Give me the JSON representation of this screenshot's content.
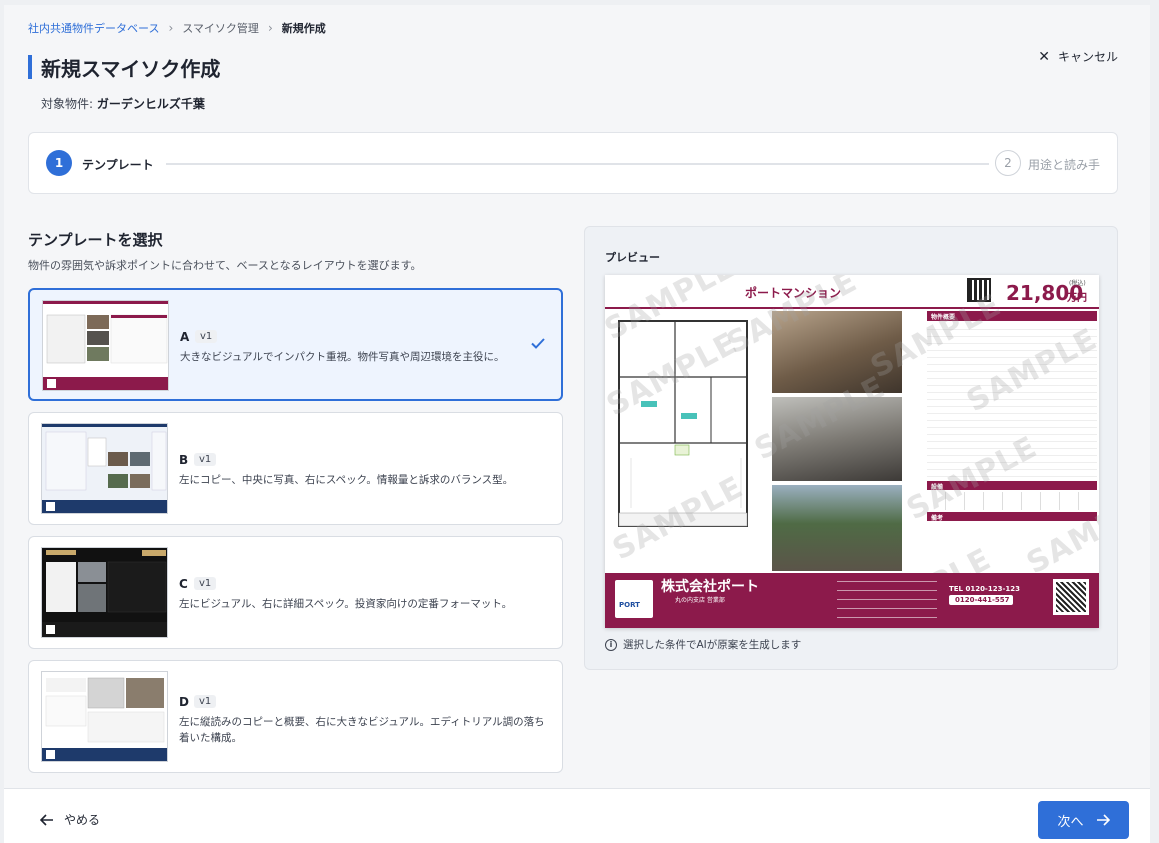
{
  "breadcrumb": {
    "root": "社内共通物件データベース",
    "parent": "スマイソク管理",
    "current": "新規作成"
  },
  "header": {
    "title": "新規スマイソク作成",
    "property_label": "対象物件: ",
    "property_name": "ガーデンヒルズ千葉",
    "cancel_label": "キャンセル"
  },
  "stepper": {
    "steps": [
      {
        "number": "1",
        "label": "テンプレート",
        "active": true
      },
      {
        "number": "2",
        "label": "用途と読み手",
        "active": false
      }
    ]
  },
  "templates_section": {
    "title": "テンプレートを選択",
    "description": "物件の雰囲気や訴求ポイントに合わせて、ベースとなるレイアウトを選びます。"
  },
  "templates": [
    {
      "name": "A",
      "version": "v1",
      "description": "大きなビジュアルでインパクト重視。物件写真や周辺環境を主役に。",
      "selected": true
    },
    {
      "name": "B",
      "version": "v1",
      "description": "左にコピー、中央に写真、右にスペック。情報量と訴求のバランス型。",
      "selected": false
    },
    {
      "name": "C",
      "version": "v1",
      "description": "左にビジュアル、右に詳細スペック。投資家向けの定番フォーマット。",
      "selected": false
    },
    {
      "name": "D",
      "version": "v1",
      "description": "左に縦読みのコピーと概要、右に大きなビジュアル。エディトリアル調の落ち着いた構成。",
      "selected": false
    }
  ],
  "preview": {
    "label": "プレビュー",
    "note": "選択した条件でAIが原案を生成します",
    "flyer": {
      "property_title": "ポートマンション",
      "price": "21,800",
      "price_unit": "万円",
      "price_note": "(税込)",
      "spec_header": "物件概要",
      "facility_header": "設備",
      "remarks_header": "備考",
      "watermark": "SAMPLE",
      "company_name": "株式会社ポート",
      "company_branch": "丸の内支店 営業部",
      "logo_text": "PORT",
      "tel": "TEL 0120-123-123",
      "free_dial": "0120-441-557"
    }
  },
  "footer": {
    "back_label": "やめる",
    "next_label": "次へ"
  },
  "colors": {
    "accent": "#2f6fd8",
    "flyer_brand": "#8c1a4b"
  }
}
